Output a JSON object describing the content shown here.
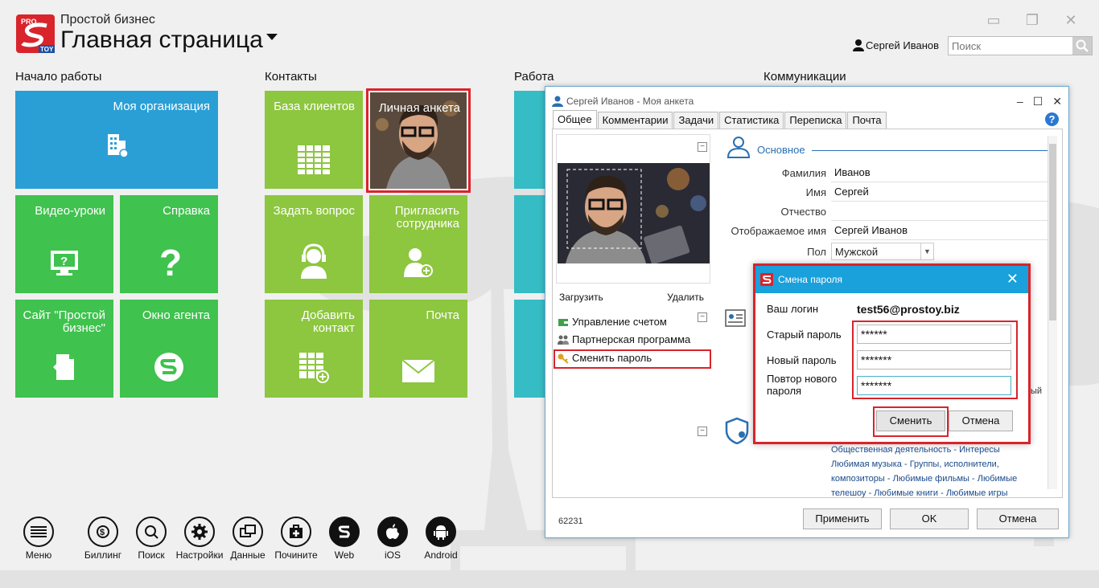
{
  "header": {
    "app_title": "Простой бизнес",
    "page_title": "Главная страница",
    "user_name": "Сергей Иванов",
    "search_placeholder": "Поиск"
  },
  "sections": {
    "start": "Начало работы",
    "contacts": "Контакты",
    "work": "Работа",
    "comm": "Коммуникации"
  },
  "tiles": {
    "my_org": "Моя организация",
    "video": "Видео-уроки",
    "help": "Справка",
    "site": "Сайт \"Простой бизнес\"",
    "agent": "Окно агента",
    "clients": "База клиентов",
    "profile": "Личная анкета",
    "ask": "Задать вопрос",
    "invite": "Пригласить сотрудника",
    "add_contact": "Добавить контакт",
    "mail": "Почта"
  },
  "bottombar": [
    "Меню",
    "Биллинг",
    "Поиск",
    "Настройки",
    "Данные",
    "Почините",
    "Web",
    "iOS",
    "Android"
  ],
  "dialog": {
    "title": "Сергей Иванов - Моя анкета",
    "tabs": [
      "Общее",
      "Комментарии",
      "Задачи",
      "Статистика",
      "Переписка",
      "Почта"
    ],
    "upload": "Загрузить",
    "delete": "Удалить",
    "links": [
      "Управление счетом",
      "Партнерская программа",
      "Сменить пароль"
    ],
    "section_main": "Основное",
    "fields": [
      {
        "label": "Фамилия",
        "value": "Иванов"
      },
      {
        "label": "Имя",
        "value": "Сергей"
      },
      {
        "label": "Отчество",
        "value": ""
      },
      {
        "label": "Отображаемое имя",
        "value": "Сергей Иванов"
      },
      {
        "label": "Пол",
        "value": "Мужской"
      }
    ],
    "interests": [
      "Общественная деятельность - Интересы",
      "Любимая музыка - Группы, исполнители,",
      "композиторы - Любимые фильмы - Любимые",
      "телешоу - Любимые книги - Любимые игры"
    ],
    "partial_text": "ый",
    "id": "62231",
    "apply": "Применить",
    "ok": "OK",
    "cancel": "Отмена"
  },
  "password_dialog": {
    "title": "Смена пароля",
    "login_label": "Ваш логин",
    "login_value": "test56@prostoy.biz",
    "old_label": "Старый пароль",
    "old_value": "******",
    "new_label": "Новый пароль",
    "new_value": "*******",
    "repeat_label": "Повтор нового пароля",
    "repeat_value": "*******",
    "change": "Сменить",
    "cancel": "Отмена"
  },
  "colors": {
    "green": "#3fc24e",
    "lime": "#8dc63f",
    "blue": "#2a9fd6",
    "teal": "#35bcc4",
    "highlight": "#d9242b",
    "dialog_header": "#1aa0db"
  }
}
